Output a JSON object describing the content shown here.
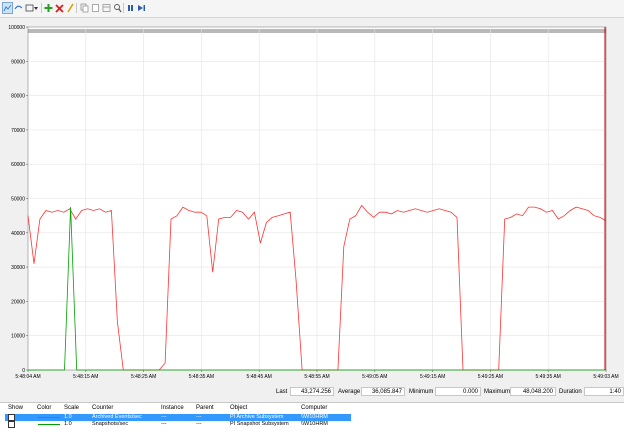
{
  "toolbar": {
    "buttons": [
      {
        "name": "view-graph-icon",
        "color": "#3b7dd8"
      },
      {
        "name": "view-current-activity-icon",
        "color": "#3b7dd8"
      },
      {
        "name": "change-graph-type-icon",
        "color": "#444444"
      },
      {
        "name": "add-counter-icon",
        "color": "#22a022"
      },
      {
        "name": "delete-counter-icon",
        "color": "#d02020"
      },
      {
        "name": "highlight-icon",
        "color": "#d0a000"
      },
      {
        "name": "copy-properties-icon",
        "color": "#888888"
      },
      {
        "name": "paste-counter-list-icon",
        "color": "#888888"
      },
      {
        "name": "properties-icon",
        "color": "#888888"
      },
      {
        "name": "zoom-icon",
        "color": "#555555"
      },
      {
        "name": "freeze-display-icon",
        "color": "#2a5db0"
      },
      {
        "name": "update-data-icon",
        "color": "#2a5db0"
      }
    ]
  },
  "chart_data": {
    "type": "line",
    "ylim": [
      0,
      100000
    ],
    "y_ticks": [
      "0",
      "10000",
      "20000",
      "30000",
      "40000",
      "50000",
      "60000",
      "70000",
      "80000",
      "90000",
      "100000"
    ],
    "x_ticks": [
      "5:48:04 AM",
      "5:48:15 AM",
      "5:48:25 AM",
      "5:48:35 AM",
      "5:48:45 AM",
      "5:48:55 AM",
      "5:49:05 AM",
      "5:49:15 AM",
      "5:49:25 AM",
      "5:49:35 AM",
      "5:49:03 AM"
    ],
    "grid": true,
    "series": [
      {
        "name": "Archived Events/sec",
        "color": "#ff3333",
        "values": [
          45000,
          31000,
          44000,
          46500,
          46000,
          46500,
          46000,
          47000,
          44000,
          46500,
          47000,
          46500,
          47000,
          46000,
          46500,
          14000,
          0,
          0,
          0,
          0,
          0,
          0,
          0,
          2000,
          44000,
          45000,
          47500,
          46500,
          46000,
          46000,
          45000,
          28500,
          44000,
          44500,
          44500,
          46500,
          46000,
          44000,
          46000,
          37000,
          43000,
          44500,
          45000,
          45500,
          46000,
          26000,
          0,
          0,
          0,
          0,
          0,
          0,
          0,
          36000,
          44000,
          45000,
          48000,
          46000,
          44500,
          46000,
          46000,
          45500,
          46500,
          46000,
          46500,
          47000,
          46500,
          46000,
          46500,
          47000,
          46500,
          46000,
          44500,
          0,
          0,
          0,
          0,
          0,
          0,
          0,
          44000,
          44500,
          45500,
          45000,
          47500,
          47500,
          47000,
          46000,
          46500,
          44000,
          45000,
          46500,
          47500,
          47000,
          46500,
          45000,
          44500,
          43500
        ]
      },
      {
        "name": "Snapshots/sec",
        "color": "#00a000",
        "values": [
          0,
          0,
          0,
          0,
          0,
          0,
          0,
          47500,
          0,
          0,
          0,
          0,
          0,
          0,
          0,
          0,
          0,
          0,
          0,
          0,
          0,
          0,
          0,
          0,
          0,
          0,
          0,
          0,
          0,
          0,
          0,
          0,
          0,
          0,
          0,
          0,
          0,
          0,
          0,
          0,
          0,
          0,
          0,
          0,
          0,
          0,
          0,
          0,
          0,
          0,
          0,
          0,
          0,
          0,
          0,
          0,
          0,
          0,
          0,
          0,
          0,
          0,
          0,
          0,
          0,
          0,
          0,
          0,
          0,
          0,
          0,
          0,
          0,
          0,
          0,
          0,
          0,
          0,
          0,
          0,
          0,
          0,
          0,
          0,
          0,
          0,
          0,
          0,
          0,
          0,
          0,
          0,
          0,
          0,
          0,
          0
        ]
      }
    ],
    "current_time_marker": 1.0
  },
  "stats": {
    "last_label": "Last",
    "last_value": "43,274.256",
    "average_label": "Average",
    "average_value": "36,085.847",
    "minimum_label": "Minimum",
    "minimum_value": "0.000",
    "maximum_label": "Maximum",
    "maximum_value": "48,048.200",
    "duration_label": "Duration",
    "duration_value": "1:40"
  },
  "legend": {
    "headers": {
      "show": "Show",
      "color": "Color",
      "scale": "Scale",
      "counter": "Counter",
      "instance": "Instance",
      "parent": "Parent",
      "object": "Object",
      "computer": "Computer"
    },
    "rows": [
      {
        "scale": "1.0",
        "counter": "Archived Events/sec",
        "instance": "---",
        "parent": "---",
        "object": "PI Archive Subsystem",
        "computer": "\\\\W10HRM",
        "color": "#ff3333",
        "selected": true
      },
      {
        "scale": "1.0",
        "counter": "Snapshots/sec",
        "instance": "---",
        "parent": "---",
        "object": "PI Snapshot Subsystem",
        "computer": "\\\\W10HRM",
        "color": "#00a000",
        "selected": false
      }
    ]
  }
}
